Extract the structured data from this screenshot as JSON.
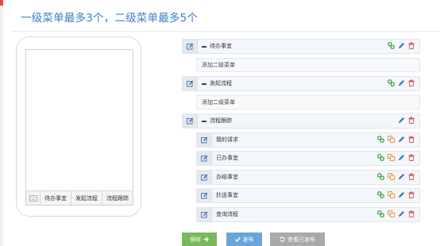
{
  "page": {
    "title": "一级菜单最多3个，二级菜单最多5个"
  },
  "preview": {
    "menu_items": [
      "待办事宜",
      "发起流程",
      "流程跟踪"
    ]
  },
  "menus": [
    {
      "label": "待办事宜",
      "add_label": "添加二级菜单"
    },
    {
      "label": "发起流程",
      "add_label": "添加二级菜单"
    },
    {
      "label": "流程跟踪",
      "children": [
        "我的请求",
        "已办事宜",
        "办结事宜",
        "抄送事宜",
        "查询流程"
      ]
    }
  ],
  "buttons": {
    "save": "保存",
    "publish": "发布",
    "view_published": "查看已发布"
  },
  "colors": {
    "title": "#3a7fc7",
    "link": "#3a9a3a",
    "edit": "#3a6fb0",
    "delete": "#d9534f",
    "copy": "#e8913a",
    "save_btn": "#7ab85d",
    "publish_btn": "#6aa5d8",
    "view_btn": "#a9a9a9"
  }
}
